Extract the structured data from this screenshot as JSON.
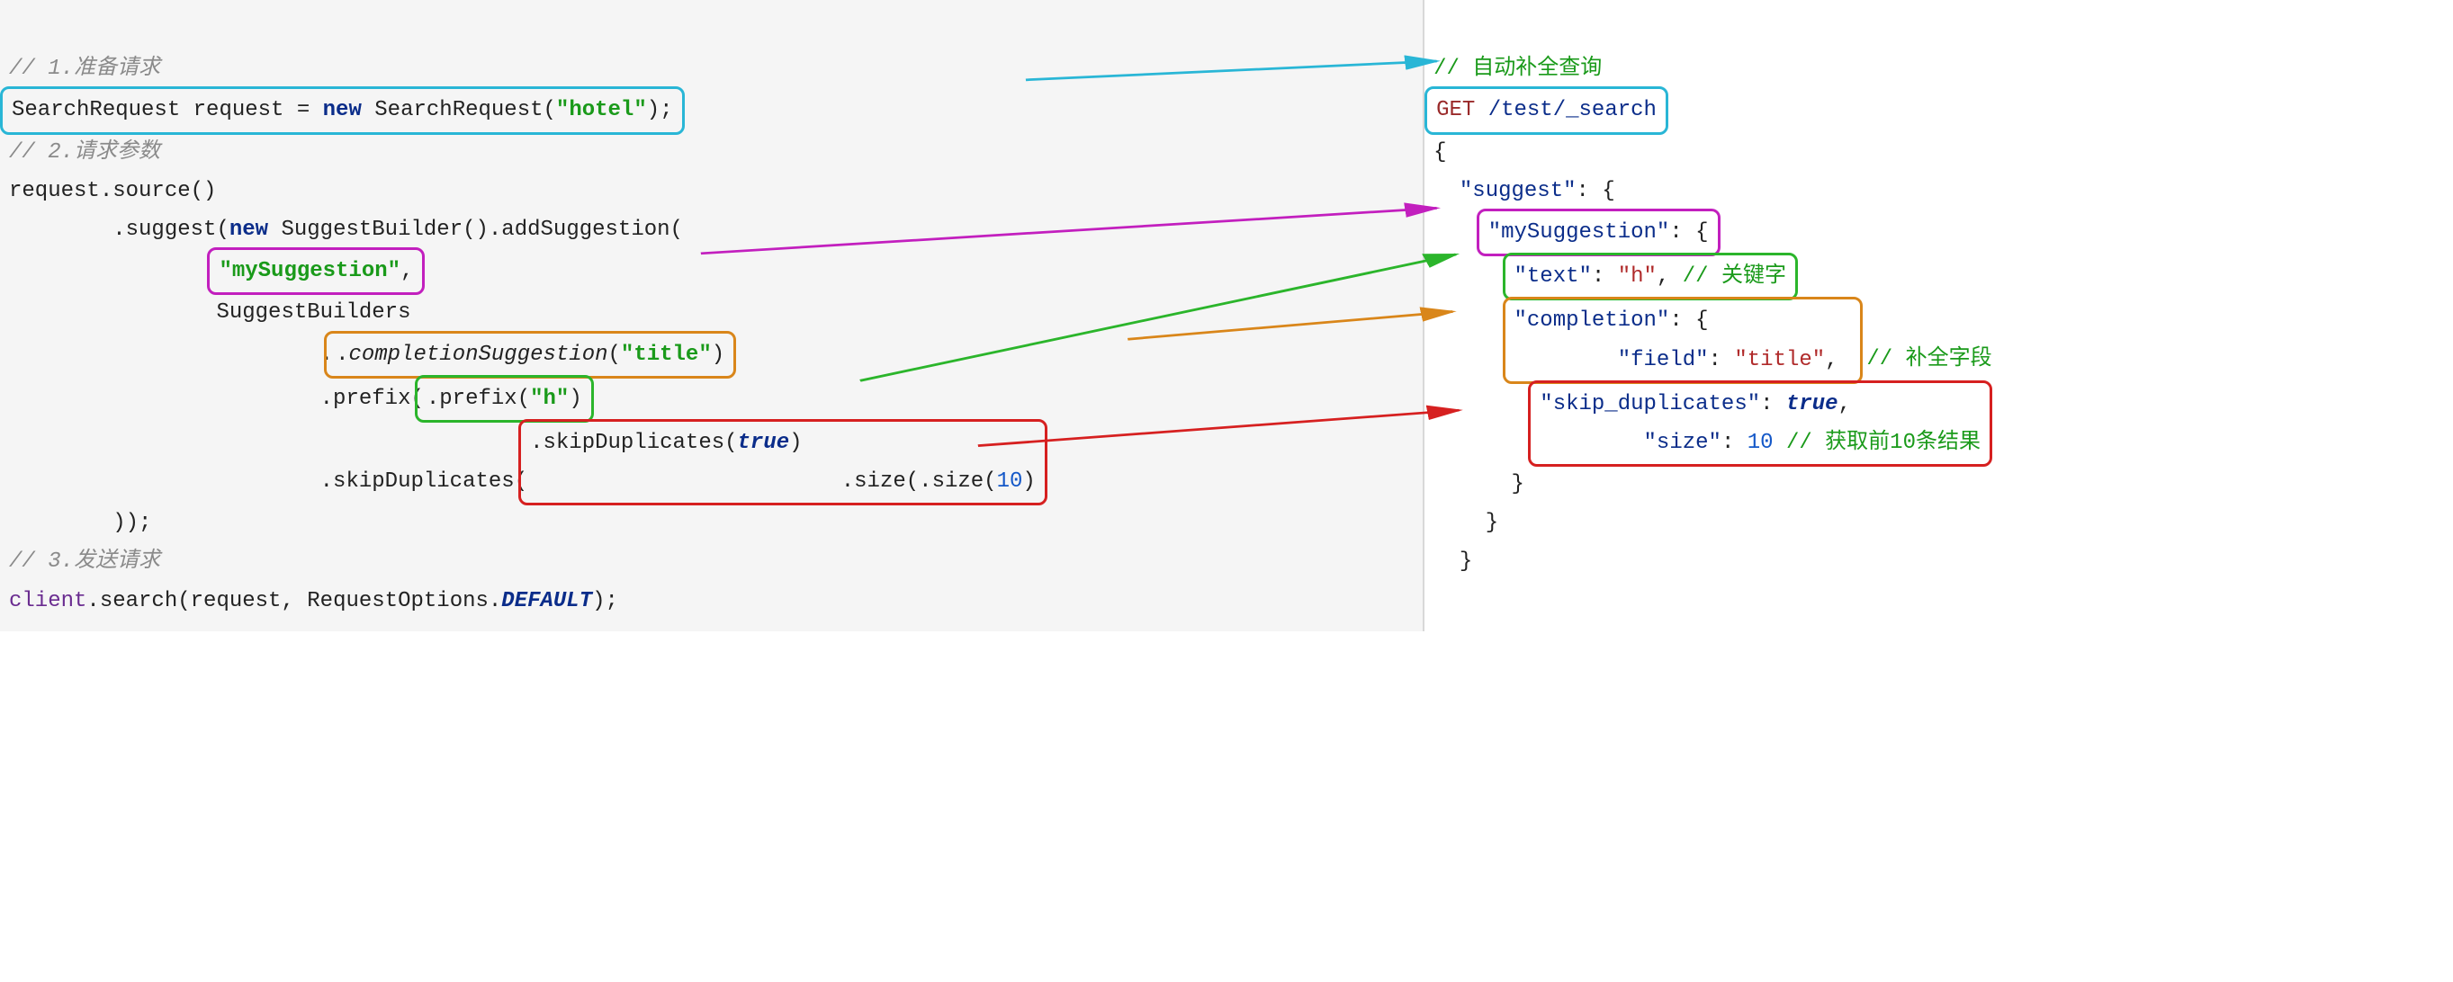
{
  "left": {
    "c1": "// 1.准备请求",
    "l2a": "SearchRequest request = ",
    "l2_new": "new",
    "l2b": " SearchRequest(",
    "l2_str": "\"hotel\"",
    "l2c": ");",
    "c3": "// 2.请求参数",
    "l4": "request.source()",
    "l5a": "        .suggest(",
    "l5_new": "new",
    "l5b": " SuggestBuilder().addSuggestion(",
    "l6a": "                ",
    "l6_str": "\"mySuggestion\"",
    "l6b": ",",
    "l7": "                SuggestBuilders",
    "l8a": "                        .",
    "l8_m": "completionSuggestion",
    "l8b": "(",
    "l8_str": "\"title\"",
    "l8c": ")",
    "l9a": "                        .prefix(",
    "l9_str": "\"h\"",
    "l9b": ")",
    "l10a": "                        .skipDuplicates(",
    "l10_true": "true",
    "l10b": ")",
    "l11a": "                        .size(",
    "l11_num": "10",
    "l11b": ")",
    "l12": "        ));",
    "c13": "// 3.发送请求",
    "l14_client": "client",
    "l14a": ".search(request, RequestOptions.",
    "l14_def": "DEFAULT",
    "l14b": ");"
  },
  "right": {
    "c1": "// 自动补全查询",
    "l2_m": "GET",
    "l2_p": " /test/_search",
    "l3": "{",
    "l4a": "  ",
    "l4_k": "\"suggest\"",
    "l4b": ": {",
    "l5a": "    ",
    "l5_k": "\"mySuggestion\"",
    "l5b": ": {",
    "l6a": "      ",
    "l6_k": "\"text\"",
    "l6b": ": ",
    "l6_v": "\"h\"",
    "l6c": ", ",
    "l6_cmt": "// 关键字",
    "l7a": "      ",
    "l7_k": "\"completion\"",
    "l7b": ": {",
    "l8a": "        ",
    "l8_k": "\"field\"",
    "l8b": ": ",
    "l8_v": "\"title\"",
    "l8c": ", ",
    "l8_cmt": "// 补全字段",
    "l9a": "        ",
    "l9_k": "\"skip_duplicates\"",
    "l9b": ": ",
    "l9_v": "true",
    "l9c": ",",
    "l10a": "        ",
    "l10_k": "\"size\"",
    "l10b": ": ",
    "l10_v": "10",
    "l10c": " ",
    "l10_cmt": "// 获取前10条结果",
    "l11": "      }",
    "l12": "    }",
    "l13": "  }"
  }
}
